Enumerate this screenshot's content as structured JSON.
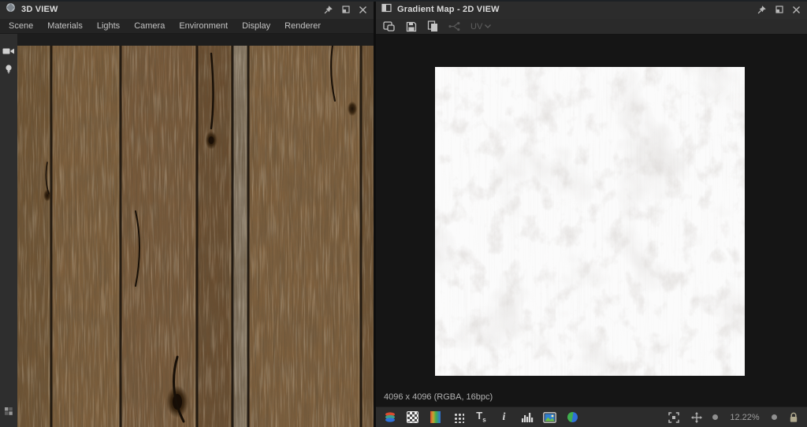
{
  "left_panel": {
    "title": "3D VIEW",
    "menu": [
      "Scene",
      "Materials",
      "Lights",
      "Camera",
      "Environment",
      "Display",
      "Renderer"
    ],
    "sidebar_icons": [
      "camera-icon",
      "lightbulb-icon",
      "stats-grid-icon"
    ],
    "window_icons": [
      "pin-icon",
      "float-icon",
      "close-icon"
    ],
    "viewport_content": "wood-planks-material-preview"
  },
  "right_panel": {
    "title": "Gradient Map - 2D VIEW",
    "toolbar": {
      "icons": [
        "duplicate-view-icon",
        "save-icon",
        "copy-icon",
        "compare-icon",
        "uv-dropdown"
      ],
      "uv_label": "UV",
      "disabled_items": [
        "compare-icon",
        "uv-dropdown"
      ]
    },
    "image_info": {
      "status": "4096 x 4096 (RGBA, 16bpc)"
    },
    "canvas_content": "white-grunge-texture-preview",
    "bottom_toolbar": {
      "left_icons": [
        "channels-icon",
        "alpha-checker-icon",
        "gradient-icon",
        "grid-icon",
        "tiling-icon",
        "info-icon",
        "histogram-icon",
        "background-image-icon",
        "color-mode-icon"
      ],
      "tiling_glyph": "T",
      "tiling_sub": "s",
      "info_glyph": "i",
      "right_icons": [
        "fit-frame-icon",
        "pan-icon",
        "zoom-out-button",
        "zoom-level",
        "zoom-in-button",
        "lock-icon"
      ],
      "zoom_level": "12.22%"
    },
    "window_icons": [
      "pin-icon",
      "float-icon",
      "close-icon"
    ]
  },
  "colors": {
    "titlebar": "#2c2c2c",
    "menubar": "#242424",
    "canvas_background": "#151515",
    "bottombar": "#2c2c2c",
    "accent_red": "#d84b2f",
    "accent_green": "#3fae4e",
    "accent_blue": "#2f6fd8"
  }
}
